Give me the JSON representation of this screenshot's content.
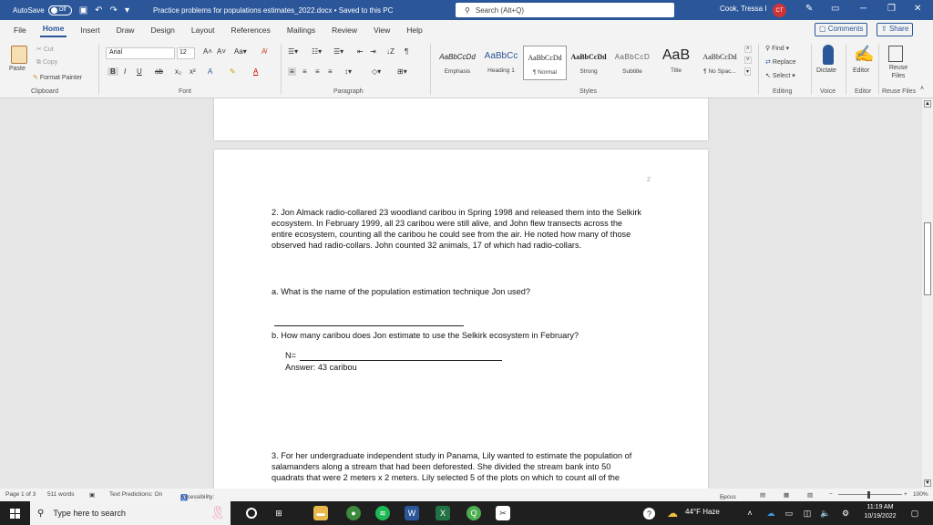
{
  "titlebar": {
    "autosave_label": "AutoSave",
    "autosave_state": "Off",
    "doc_title": "Practice problems for populations estimates_2022.docx  •  Saved to this PC",
    "search_placeholder": "Search (Alt+Q)",
    "user_name": "Cook, Tressa I",
    "user_initials": "CT"
  },
  "menu": {
    "tabs": [
      "File",
      "Home",
      "Insert",
      "Draw",
      "Design",
      "Layout",
      "References",
      "Mailings",
      "Review",
      "View",
      "Help"
    ],
    "active_tab": "Home",
    "comments_label": "Comments",
    "share_label": "Share"
  },
  "ribbon": {
    "clipboard": {
      "paste": "Paste",
      "cut": "Cut",
      "copy": "Copy",
      "format_painter": "Format Painter",
      "label": "Clipboard"
    },
    "font": {
      "family": "Arial",
      "size": "12",
      "label": "Font"
    },
    "paragraph": {
      "label": "Paragraph"
    },
    "styles": {
      "label": "Styles",
      "items": [
        {
          "sample": "AaBbCcDd",
          "name": "Emphasis"
        },
        {
          "sample": "AaBbCc",
          "name": "Heading 1"
        },
        {
          "sample": "AaBbCcDd",
          "name": "¶ Normal"
        },
        {
          "sample": "AaBbCcDd",
          "name": "Strong"
        },
        {
          "sample": "AaBbCcD",
          "name": "Subtitle"
        },
        {
          "sample": "AaB",
          "name": "Title"
        },
        {
          "sample": "AaBbCcDd",
          "name": "¶ No Spac..."
        }
      ]
    },
    "editing": {
      "find": "Find",
      "replace": "Replace",
      "select": "Select",
      "label": "Editing"
    },
    "voice": {
      "dictate": "Dictate",
      "label": "Voice"
    },
    "editor": {
      "editor": "Editor",
      "label": "Editor"
    },
    "reuse": {
      "reuse_files": "Reuse Files",
      "label": "Reuse Files"
    }
  },
  "document": {
    "page_number": "2",
    "q2": "2.  Jon Almack radio-collared 23 woodland caribou in Spring 1998 and released them into the Selkirk ecosystem.  In February 1999, all 23 caribou were still alive, and John flew transects across the entire ecosystem, counting all the caribou he could see from the air.  He noted how many of those observed had radio-collars.  John counted 32 animals, 17 of which had radio-collars.",
    "q2_a": "a.  What is the name of the population estimation technique Jon used?",
    "q2_b": "b.  How many caribou does Jon estimate to use the Selkirk ecosystem in February?",
    "n_label": "N=",
    "answer": "Answer: 43 caribou",
    "q3": "3. For her undergraduate independent study in Panama, Lily wanted to estimate the population of salamanders along a stream that had been deforested.  She divided the stream bank into 50 quadrats that were 2 meters x 2 meters.  Lily selected 5 of the plots on which to count all of the"
  },
  "statusbar": {
    "page": "Page 1 of 3",
    "words": "511 words",
    "text_predictions": "Text Predictions: On",
    "accessibility": "Accessibility: Investigate",
    "focus": "Focus",
    "zoom": "100%"
  },
  "taskbar": {
    "search_placeholder": "Type here to search",
    "weather": "44°F  Haze",
    "time": "11:19 AM",
    "date": "10/19/2022"
  }
}
